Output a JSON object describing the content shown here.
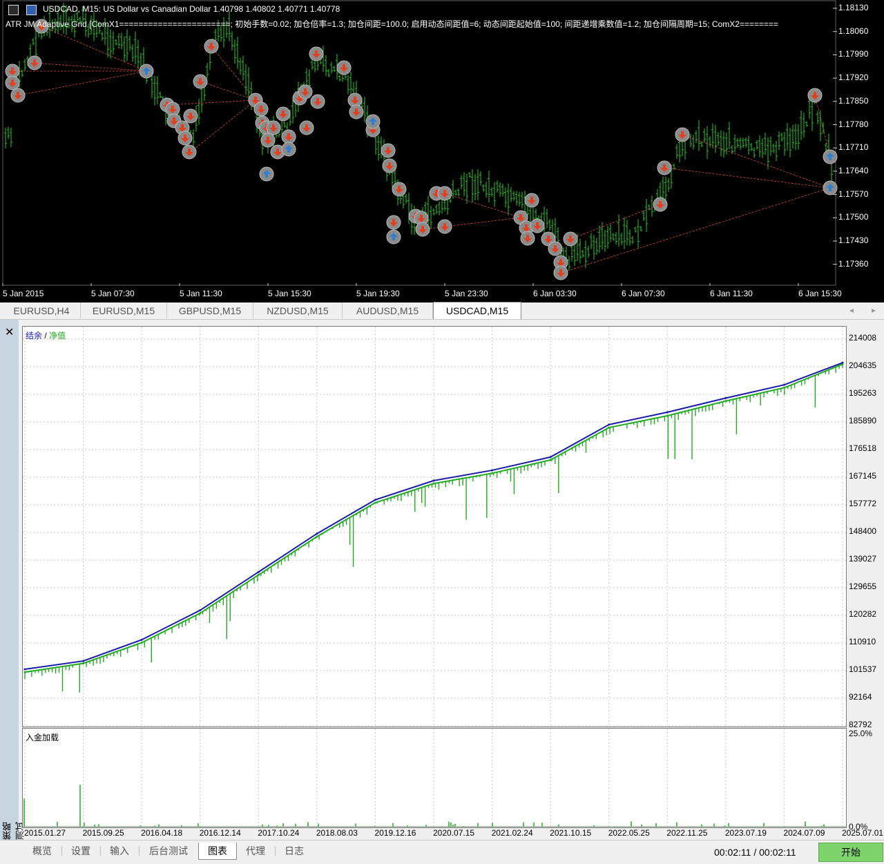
{
  "price_chart": {
    "title": "USDCAD, M15:  US Dollar vs Canadian Dollar  1.40798 1.40802 1.40771 1.40778",
    "ea_params": "ATR JM Adaptive Grid [ComX1=======================; 初始手数=0.02; 加仓倍率=1.3; 加仓间距=100.0; 启用动态间距值=6; 动态间距起始值=100; 间距递增乘数值=1.2; 加仓间隔周期=15; ComX2========",
    "price_labels": [
      "1.18130",
      "1.18060",
      "1.17990",
      "1.17920",
      "1.17850",
      "1.17780",
      "1.17710",
      "1.17640",
      "1.17570",
      "1.17500",
      "1.17430",
      "1.17360"
    ],
    "time_labels": [
      "5 Jan 2015",
      "5 Jan 07:30",
      "5 Jan 11:30",
      "5 Jan 15:30",
      "5 Jan 19:30",
      "5 Jan 23:30",
      "6 Jan 03:30",
      "6 Jan 07:30",
      "6 Jan 11:30",
      "6 Jan 15:30"
    ],
    "colors": {
      "background": "#000000",
      "bars": "#22cc22",
      "trade_lines": "#d84a3a",
      "sell_arrow": "#e04020",
      "buy_arrow": "#2f7fd0",
      "marker": "#8a8a8a"
    }
  },
  "symbol_tabs": {
    "items": [
      {
        "label": "EURUSD,H4",
        "active": false
      },
      {
        "label": "EURUSD,M15",
        "active": false
      },
      {
        "label": "GBPUSD,M15",
        "active": false
      },
      {
        "label": "NZDUSD,M15",
        "active": false
      },
      {
        "label": "AUDUSD,M15",
        "active": false
      },
      {
        "label": "USDCAD,M15",
        "active": true
      }
    ],
    "prev_arrow": "◂",
    "next_arrow": "▸"
  },
  "side_panel": {
    "close": "✕",
    "label": "策略测试"
  },
  "chart_data": [
    {
      "type": "line",
      "legend": {
        "balance": "结余",
        "separator": " / ",
        "equity": "净值"
      },
      "yticks": [
        "214008",
        "204635",
        "195263",
        "185890",
        "176518",
        "167145",
        "157772",
        "148400",
        "139027",
        "129655",
        "120282",
        "110910",
        "101537",
        "92164",
        "82792"
      ],
      "ylim": [
        82792,
        214008
      ],
      "x": [
        "2015.01.27",
        "2015.09.25",
        "2016.04.18",
        "2016.12.14",
        "2017.10.24",
        "2018.08.03",
        "2019.12.16",
        "2020.07.15",
        "2021.02.24",
        "2021.10.15",
        "2022.05.25",
        "2022.11.25",
        "2023.07.19",
        "2024.07.09",
        "2025.07.01"
      ],
      "series": [
        {
          "name": "结余",
          "color": "#1a1aaa",
          "values": [
            102000,
            104800,
            112000,
            122000,
            135000,
            148000,
            159500,
            166000,
            169500,
            174000,
            185000,
            189200,
            194000,
            198500,
            206000
          ]
        },
        {
          "name": "净值",
          "color": "#22aa22",
          "values": [
            101000,
            104000,
            111000,
            121000,
            134000,
            147000,
            158500,
            165000,
            168500,
            173000,
            184000,
            188000,
            193000,
            197500,
            205500
          ]
        }
      ]
    },
    {
      "type": "bar",
      "title": "入金加载",
      "yticks": [
        "25.0%",
        "0.0%"
      ],
      "ylim": [
        0,
        25
      ],
      "color": "#22aa22"
    }
  ],
  "bottom_tabs": {
    "items": [
      {
        "label": "概览",
        "active": false
      },
      {
        "label": "设置",
        "active": false
      },
      {
        "label": "输入",
        "active": false
      },
      {
        "label": "后台测试",
        "active": false
      },
      {
        "label": "图表",
        "active": true
      },
      {
        "label": "代理",
        "active": false
      },
      {
        "label": "日志",
        "active": false
      }
    ],
    "timer": "00:02:11 / 00:02:11",
    "start": "开始"
  }
}
